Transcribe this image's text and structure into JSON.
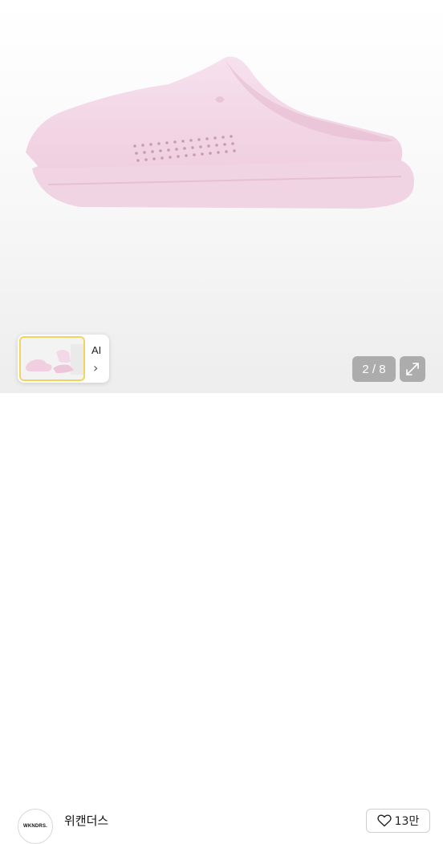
{
  "viewer": {
    "product_image": "pink-clog-mule",
    "ai_card": {
      "label": "AI",
      "chevron": "›"
    },
    "counter": "2 / 8",
    "expand_icon": "expand-arrows-icon"
  },
  "seller": {
    "avatar_text": "WKNDRS.",
    "name": "위캔더스"
  },
  "like": {
    "icon": "heart-outline-icon",
    "count": "13만"
  },
  "colors": {
    "shoe_pink": "#f3d7e6",
    "accent_yellow": "#f2d35b"
  }
}
